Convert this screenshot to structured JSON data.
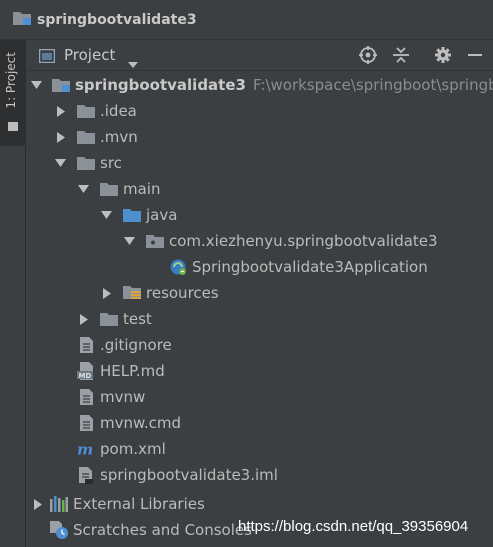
{
  "titlebar": {
    "title": "springbootvalidate3"
  },
  "sidebar": {
    "tab_label": "1: Project"
  },
  "toolbar": {
    "view_label": "Project",
    "icons": [
      "crosshair-icon",
      "collapse-all-icon",
      "gear-icon",
      "minimize-icon"
    ]
  },
  "tree": {
    "root": {
      "label": "springbootvalidate3",
      "path": "F:\\workspace\\springboot\\springbo"
    },
    "idea": ".idea",
    "mvn": ".mvn",
    "src": "src",
    "main": "main",
    "java": "java",
    "package": "com.xiezhenyu.springbootvalidate3",
    "app_class": "Springbootvalidate3Application",
    "resources": "resources",
    "test": "test",
    "gitignore": ".gitignore",
    "help": "HELP.md",
    "mvnw": "mvnw",
    "mvnw_cmd": "mvnw.cmd",
    "pom": "pom.xml",
    "iml": "springbootvalidate3.iml",
    "external_libraries": "External Libraries",
    "scratches": "Scratches and Consoles"
  },
  "watermark": "https://blog.csdn.net/qq_39356904",
  "colors": {
    "background": "#3c3f41",
    "text": "#bbbbbb",
    "folder": "#8a9199",
    "source_folder": "#4e8fd0",
    "maven_icon": "#4f8dd6"
  }
}
